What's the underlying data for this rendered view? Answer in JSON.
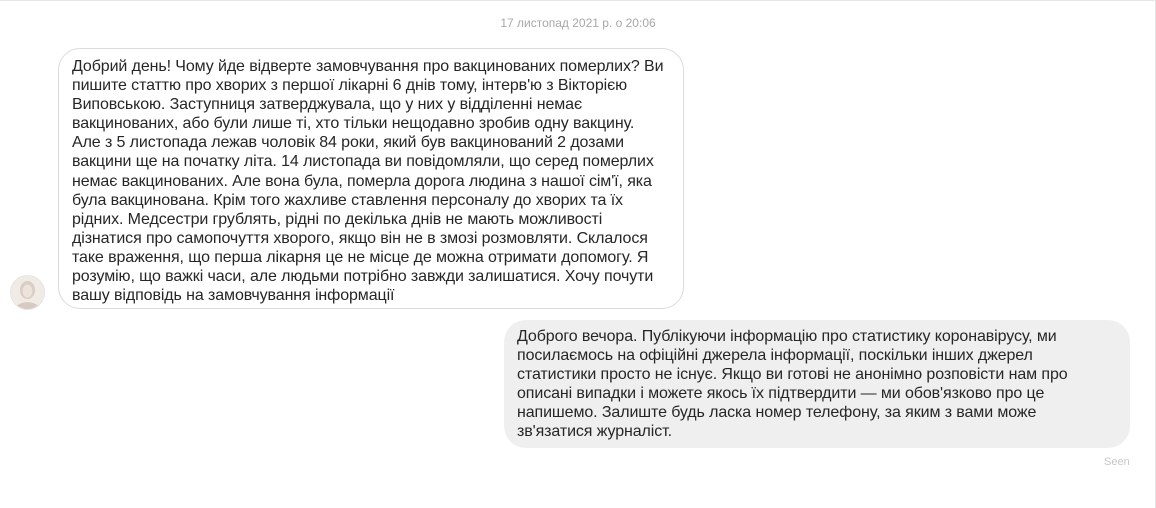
{
  "conversation": {
    "timestamp": "17 листопад 2021 р. о 20:06",
    "incoming_message": {
      "avatar_icon": "user-avatar",
      "text": "Добрий день! Чому йде відверте замовчування про вакцинованих померлих? Ви\nпишите статтю про хворих з першої лікарні  6 днів тому, інтерв'ю з Вікторією\nВиповською. Заступниця затверджувала, що у них у відділенні немає\nвакцинованих, або були лише ті, хто тільки нещодавно зробив одну вакцину.\nАле з 5 листопада лежав чоловік 84 роки, який був вакцинований 2 дозами\nвакцини ще на початку літа. 14 листопада ви  повідомляли, що серед померлих\nнемає вакцинованих. Але вона була, померла дорога людина з нашої сім'ї, яка\nбула вакцинована. Крім того жахливе ставлення персоналу до хворих та їх\nрідних. Медсестри грублять, рідні по декілька днів не мають можливості\nдізнатися про самопочуття хворого, якщо він не в змозі розмовляти. Склалося\nтаке враження, що перша лікарня це не місце де можна отримати допомогу. Я\nрозумію, що важкі часи, але людьми потрібно завжди залишатися.  Хочу почути\nвашу відповідь на замовчування інформації"
    },
    "outgoing_message": {
      "text": "Доброго вечора. Публікуючи інформацію про статистику коронавірусу, ми\nпосилаємось на офіційні джерела інформації, поскільки інших джерел\nстатистики просто не існує. Якщо ви готові не анонімно розповісти нам про\nописані випадки і можете якось їх підтвердити — ми обов'язково про це\nнапишемо. Залиште будь ласка номер телефону, за яким з вами може\nзв'язатися журналіст."
    },
    "seen_label": "Seen"
  }
}
